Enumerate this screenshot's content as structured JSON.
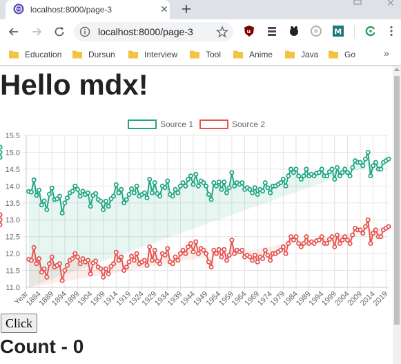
{
  "browser": {
    "tab_title": "localhost:8000/page-3",
    "url": "localhost:8000/page-3",
    "bookmarks": [
      "Education",
      "Dursun",
      "Interview",
      "Tool",
      "Anime",
      "Java",
      "Go"
    ],
    "bookmarks_more": "»",
    "extensions": [
      "ublock-icon",
      "list-extension-icon",
      "gimp-icon",
      "timer-icon",
      "m-extension-icon",
      "refresh-extension-icon"
    ]
  },
  "page": {
    "heading": "Hello mdx!",
    "button_label": "Click",
    "count_label": "Count - 0"
  },
  "colors": {
    "source1": "#20a683",
    "source2": "#e6544f"
  },
  "chart_data": {
    "type": "area",
    "legend_position": "top",
    "grid": true,
    "ylim": [
      11.0,
      15.5
    ],
    "yticks": [
      "15.5",
      "15.0",
      "14.5",
      "14.0",
      "13.5",
      "13.0",
      "12.5",
      "12.0",
      "11.5",
      "11.0"
    ],
    "x_tick_labels": [
      "Year",
      "1884",
      "1889",
      "1894",
      "1899",
      "1904",
      "1909",
      "1914",
      "1919",
      "1924",
      "1929",
      "1934",
      "1939",
      "1944",
      "1949",
      "1954",
      "1959",
      "1964",
      "1969",
      "1974",
      "1979",
      "1984",
      "1989",
      "1994",
      "1999",
      "2004",
      "2009",
      "2014",
      "2019"
    ],
    "x": [
      1880,
      1881,
      1882,
      1883,
      1884,
      1885,
      1886,
      1887,
      1888,
      1889,
      1890,
      1891,
      1892,
      1893,
      1894,
      1895,
      1896,
      1897,
      1898,
      1899,
      1900,
      1901,
      1902,
      1903,
      1904,
      1905,
      1906,
      1907,
      1908,
      1909,
      1910,
      1911,
      1912,
      1913,
      1914,
      1915,
      1916,
      1917,
      1918,
      1919,
      1920,
      1921,
      1922,
      1923,
      1924,
      1925,
      1926,
      1927,
      1928,
      1929,
      1930,
      1931,
      1932,
      1933,
      1934,
      1935,
      1936,
      1937,
      1938,
      1939,
      1940,
      1941,
      1942,
      1943,
      1944,
      1945,
      1946,
      1947,
      1948,
      1949,
      1950,
      1951,
      1952,
      1953,
      1954,
      1955,
      1956,
      1957,
      1958,
      1959,
      1960,
      1961,
      1962,
      1963,
      1964,
      1965,
      1966,
      1967,
      1968,
      1969,
      1970,
      1971,
      1972,
      1973,
      1974,
      1975,
      1976,
      1977,
      1978,
      1979,
      1980,
      1981,
      1982,
      1983,
      1984,
      1985,
      1986,
      1987,
      1988,
      1989,
      1990,
      1991,
      1992,
      1993,
      1994,
      1995,
      1996,
      1997,
      1998,
      1999,
      2000,
      2001,
      2002,
      2003,
      2004,
      2005,
      2006,
      2007,
      2008,
      2009,
      2010,
      2011,
      2012,
      2013,
      2014,
      2015,
      2016,
      2017,
      2018,
      2019,
      2020
    ],
    "series": [
      {
        "name": "Source 1",
        "values": [
          13.84,
          13.82,
          14.18,
          13.72,
          13.88,
          13.44,
          13.56,
          13.3,
          13.76,
          13.94,
          13.6,
          13.62,
          13.7,
          13.2,
          13.5,
          13.65,
          13.8,
          13.85,
          14.0,
          13.9,
          13.7,
          13.85,
          13.75,
          13.8,
          13.4,
          13.72,
          13.78,
          13.6,
          13.55,
          13.3,
          13.55,
          13.4,
          13.62,
          13.7,
          14.04,
          13.8,
          13.9,
          13.5,
          13.6,
          13.75,
          13.92,
          13.8,
          14.0,
          13.7,
          13.75,
          13.8,
          13.65,
          14.2,
          13.8,
          14.1,
          13.78,
          13.7,
          14.0,
          13.95,
          14.15,
          13.75,
          13.7,
          13.9,
          13.8,
          14.0,
          14.1,
          14.0,
          14.2,
          14.3,
          14.05,
          14.35,
          14.0,
          14.15,
          14.1,
          14.0,
          13.75,
          13.6,
          14.1,
          14.0,
          14.12,
          13.9,
          14.12,
          13.8,
          13.95,
          14.4,
          14.0,
          14.1,
          14.05,
          14.1,
          13.9,
          13.95,
          13.9,
          13.8,
          13.95,
          13.75,
          13.9,
          13.85,
          14.1,
          13.95,
          13.8,
          14.0,
          14.0,
          14.05,
          14.1,
          14.2,
          14.0,
          14.3,
          14.5,
          14.4,
          14.5,
          14.3,
          14.2,
          14.3,
          14.5,
          14.3,
          14.35,
          14.3,
          14.38,
          14.4,
          14.5,
          14.3,
          14.3,
          14.42,
          14.5,
          14.2,
          14.55,
          14.3,
          14.4,
          14.5,
          14.4,
          14.3,
          14.55,
          14.75,
          14.7,
          14.7,
          14.6,
          14.8,
          15.0,
          14.3,
          14.6,
          14.7,
          14.5,
          14.5,
          14.7,
          14.75,
          14.8,
          15.15,
          15.0,
          14.85,
          15.0,
          15.15
        ],
        "color": "#20a683"
      },
      {
        "name": "Source 2",
        "values": [
          11.83,
          11.8,
          12.18,
          11.7,
          11.85,
          11.45,
          11.55,
          11.3,
          11.7,
          11.9,
          11.6,
          11.65,
          11.7,
          11.2,
          11.5,
          11.65,
          11.8,
          11.85,
          12.0,
          11.9,
          11.7,
          11.85,
          11.75,
          11.8,
          11.4,
          11.72,
          11.78,
          11.6,
          11.55,
          11.3,
          11.55,
          11.4,
          11.62,
          11.7,
          12.04,
          11.8,
          11.9,
          11.5,
          11.6,
          11.75,
          11.92,
          11.8,
          12.0,
          11.7,
          11.75,
          11.8,
          11.65,
          12.2,
          11.8,
          12.1,
          11.78,
          11.7,
          12.0,
          11.95,
          12.15,
          11.75,
          11.7,
          11.9,
          11.8,
          12.0,
          12.1,
          12.0,
          12.2,
          12.3,
          12.05,
          12.35,
          12.0,
          12.15,
          12.1,
          12.0,
          11.75,
          11.6,
          12.1,
          12.0,
          12.12,
          11.9,
          12.12,
          11.8,
          11.95,
          12.4,
          12.0,
          12.1,
          12.05,
          12.1,
          11.9,
          11.95,
          11.9,
          11.8,
          11.95,
          11.75,
          11.9,
          11.85,
          12.1,
          11.95,
          11.8,
          12.0,
          12.0,
          12.05,
          12.1,
          12.2,
          12.0,
          12.3,
          12.5,
          12.4,
          12.5,
          12.3,
          12.2,
          12.3,
          12.5,
          12.3,
          12.35,
          12.3,
          12.38,
          12.4,
          12.5,
          12.3,
          12.3,
          12.42,
          12.5,
          12.2,
          12.55,
          12.3,
          12.4,
          12.5,
          12.4,
          12.3,
          12.55,
          12.75,
          12.7,
          12.7,
          12.6,
          12.8,
          13.0,
          12.3,
          12.6,
          12.7,
          12.5,
          12.5,
          12.7,
          12.75,
          12.8,
          13.15,
          13.0,
          12.85,
          13.0,
          13.15
        ],
        "color": "#e6544f"
      }
    ]
  }
}
